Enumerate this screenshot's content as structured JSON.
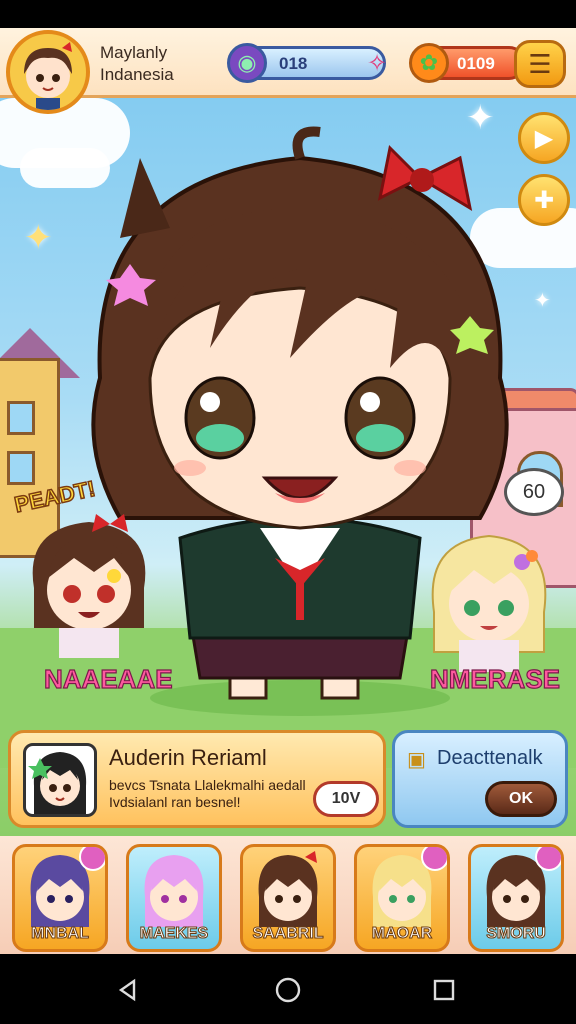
{
  "player": {
    "name_line1": "Maylanly",
    "name_line2": "Indanesia"
  },
  "resources": {
    "gems": "018",
    "coins": "0109"
  },
  "stage": {
    "ready_text": "PEADT!",
    "bubble_text": "60",
    "left_char_label": "NAAEAAE",
    "right_char_label": "NMERASE"
  },
  "panel_left": {
    "title": "Auderin Reriaml",
    "desc_line1": "bevcs Tsnata Llalekmalhi aedall",
    "desc_line2": "Ivdsialanl ran besnel!",
    "button_label": "10V"
  },
  "panel_right": {
    "title": "Deacttenalk",
    "button_label": "OK"
  },
  "roster": [
    {
      "name": "MNBAL",
      "color": "#f6b03a"
    },
    {
      "name": "MAEKES",
      "color": "#7ed8f0"
    },
    {
      "name": "SAABRIL",
      "color": "#f6b03a"
    },
    {
      "name": "MAOAR",
      "color": "#f6b03a"
    },
    {
      "name": "SMORU",
      "color": "#7ed8f0"
    }
  ],
  "colors": {
    "accent": "#f6a623",
    "hair": "#5a3220",
    "bow": "#d8262a"
  }
}
